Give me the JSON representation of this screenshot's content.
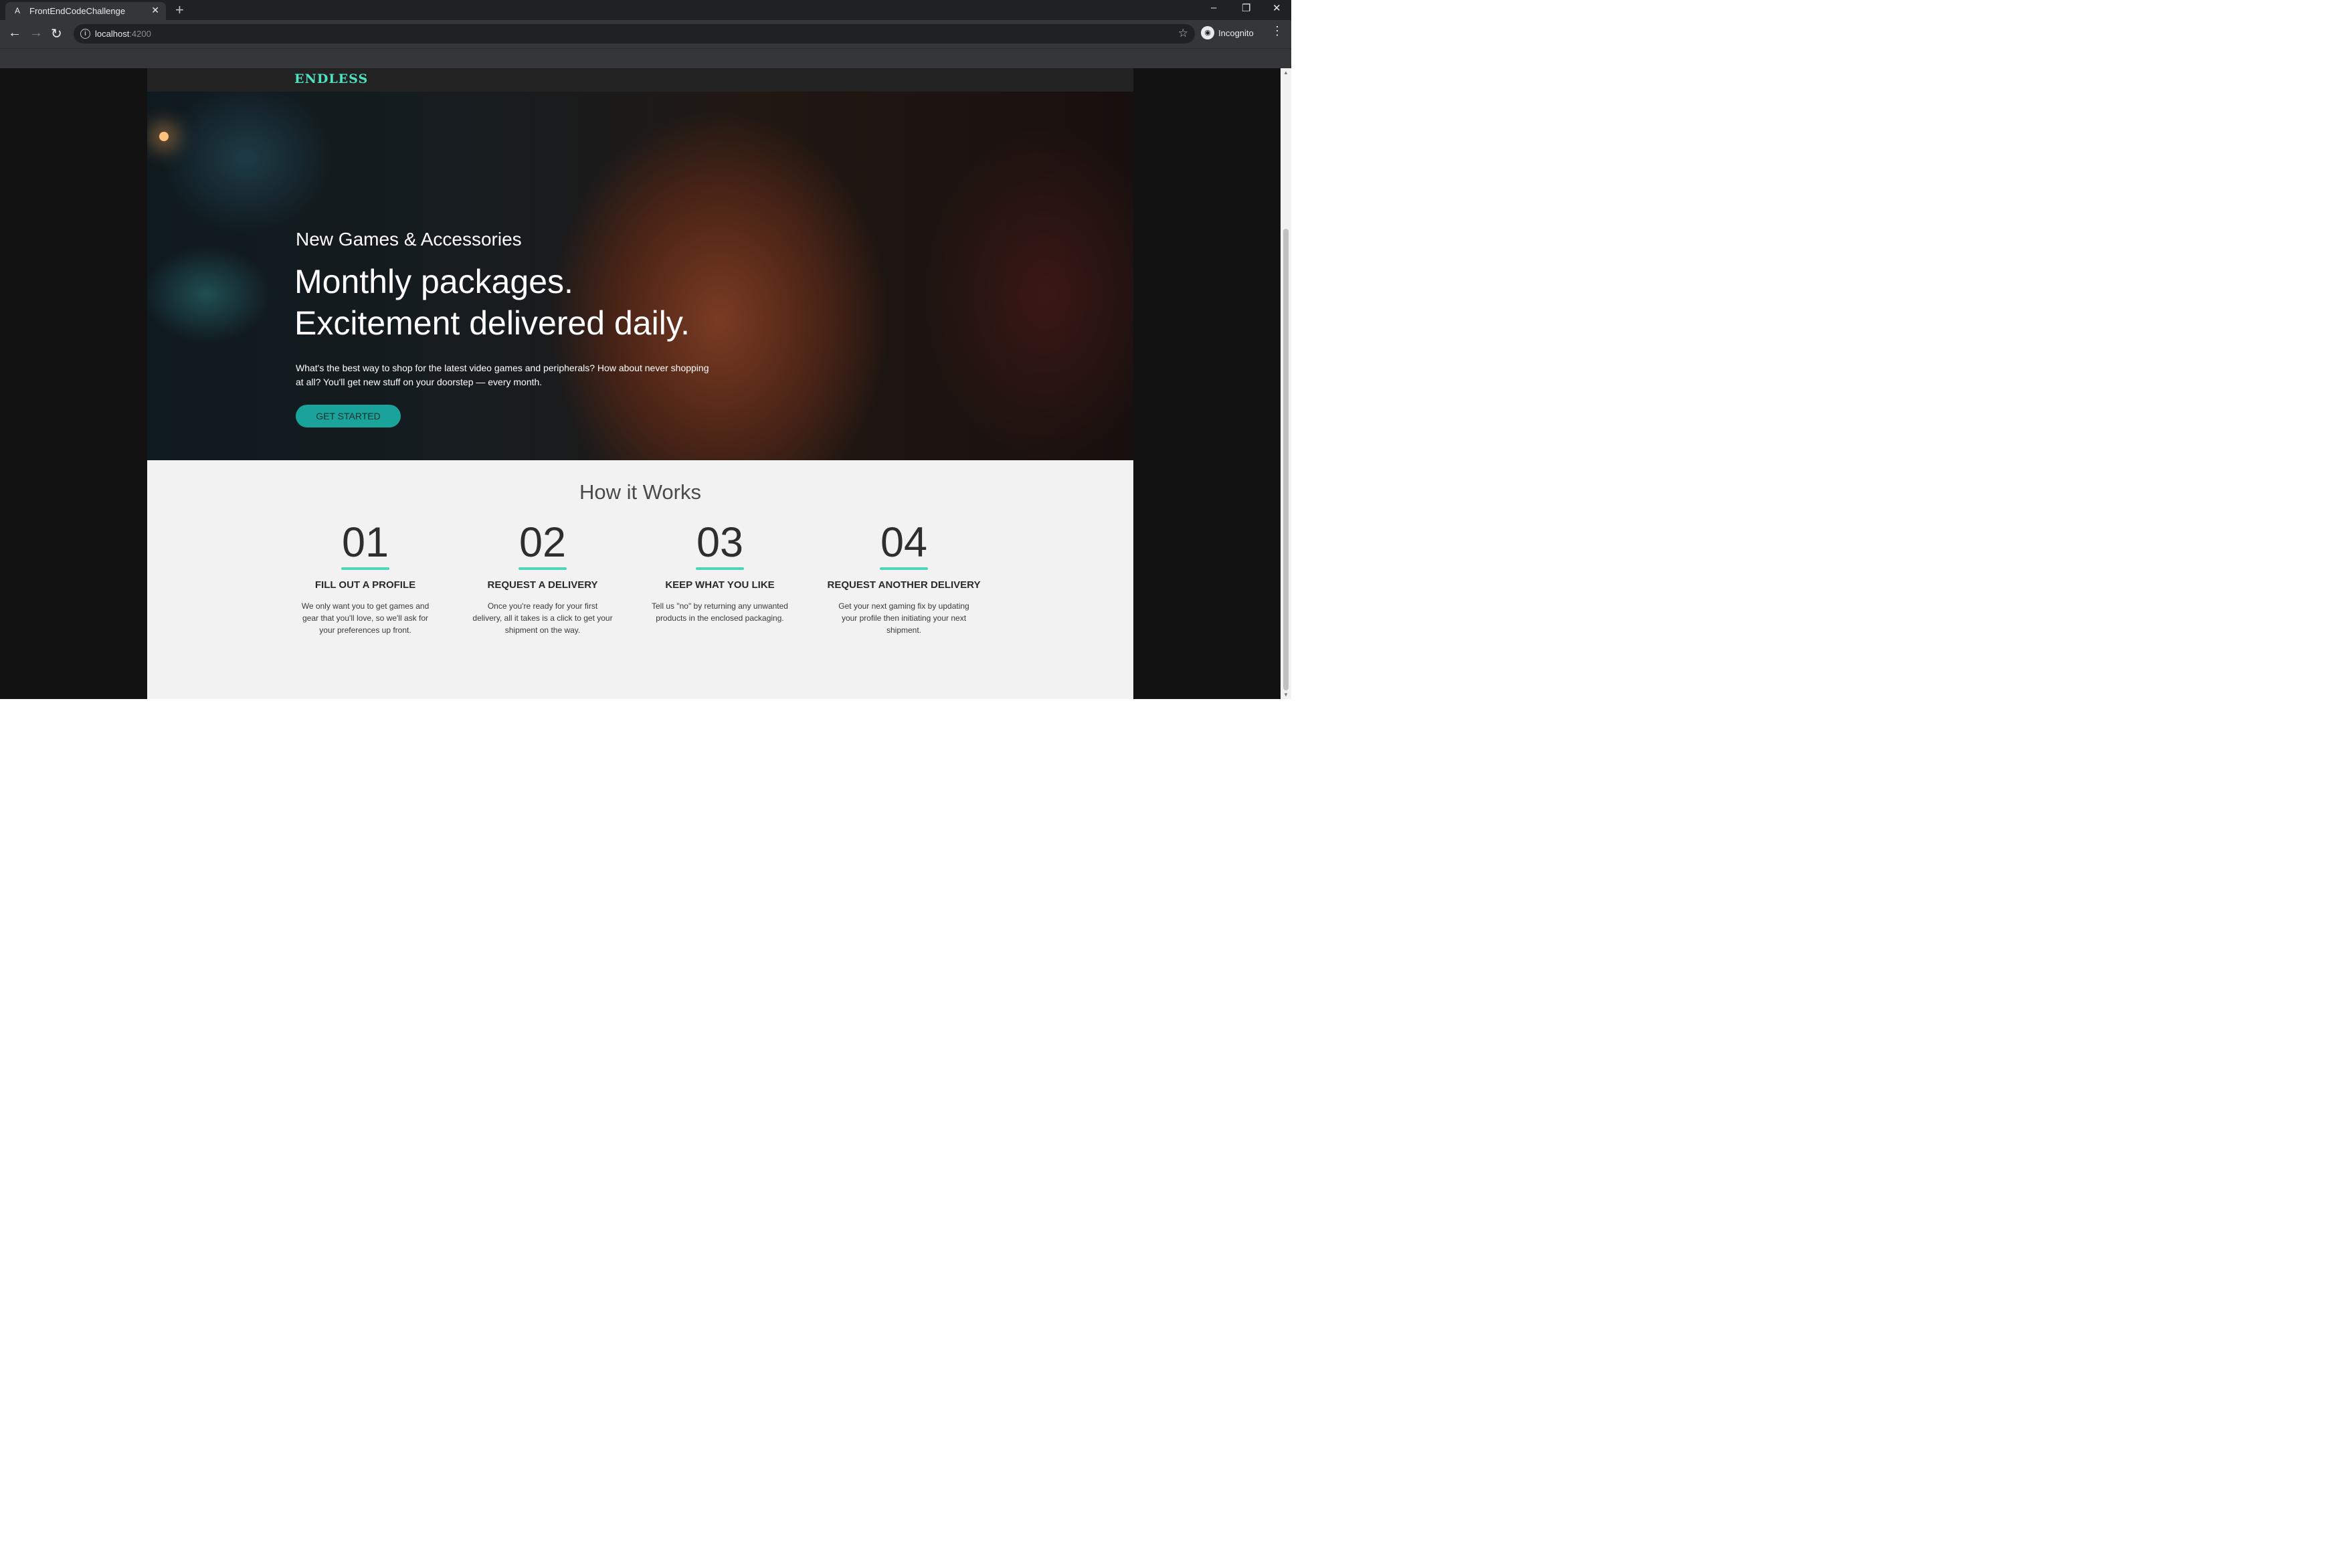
{
  "browser": {
    "tab_title": "FrontEndCodeChallenge",
    "tab_favicon": "A",
    "new_tab": "+",
    "url_host": "localhost",
    "url_port": ":4200",
    "profile_label": "Incognito",
    "icons": {
      "back": "←",
      "forward": "→",
      "reload": "↻",
      "star": "☆",
      "kebab": "⋮",
      "minimize": "–",
      "restore": "❐",
      "close": "✕",
      "tab_close": "✕",
      "info": "i",
      "incognito": "◉"
    }
  },
  "site": {
    "logo": "ENDLESS",
    "hero": {
      "subtitle": "New Games & Accessories",
      "title_line1": "Monthly packages.",
      "title_line2": "Excitement delivered daily.",
      "text": "What's the best way to shop for the latest video games and peripherals? How about never shopping at all? You'll get new stuff on your doorstep — every month.",
      "cta": "GET STARTED"
    },
    "how": {
      "title": "How it Works",
      "steps": [
        {
          "num": "01",
          "heading": "FILL OUT A PROFILE",
          "text": "We only want you to get games and gear that you'll love, so we'll ask for your preferences up front."
        },
        {
          "num": "02",
          "heading": "REQUEST A DELIVERY",
          "text": "Once you're ready for your first delivery, all it takes is a click to get your shipment on the way."
        },
        {
          "num": "03",
          "heading": "KEEP WHAT YOU LIKE",
          "text": "Tell us \"no\" by returning any unwanted products in the enclosed packaging."
        },
        {
          "num": "04",
          "heading": "REQUEST ANOTHER DELIVERY",
          "text": "Get your next gaming fix by updating your profile then initiating your next shipment."
        }
      ]
    },
    "colors": {
      "accent": "#4ee2c0",
      "cta": "#1aa39b",
      "section_bg": "#f2f2f2"
    }
  }
}
